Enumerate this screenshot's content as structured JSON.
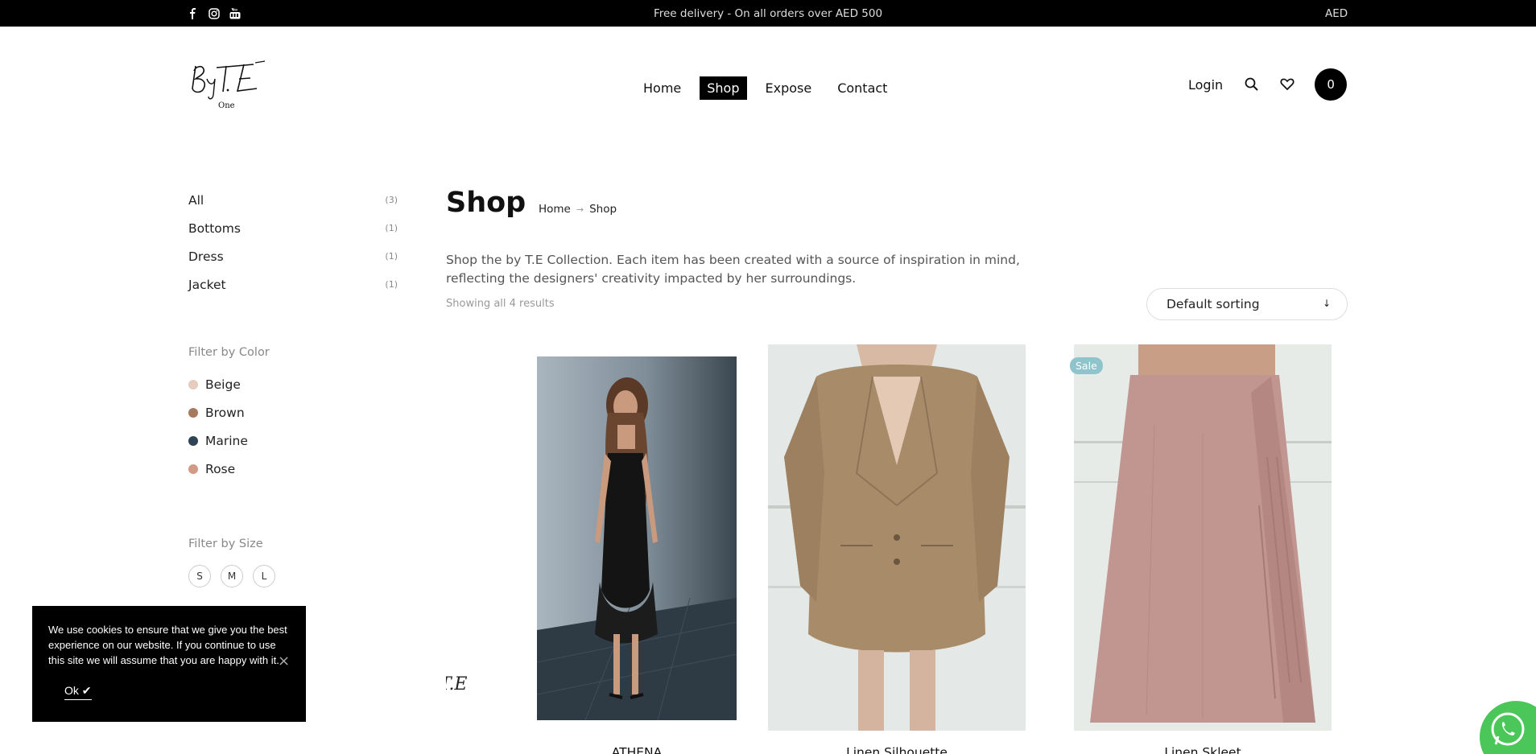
{
  "topbar": {
    "promo": "Free delivery - On all orders over AED 500",
    "currency": "AED",
    "social_icons": [
      "facebook-icon",
      "instagram-icon",
      "youtube-icon"
    ]
  },
  "header": {
    "logo_text": "ByT.E",
    "logo_sub": "One",
    "nav": [
      {
        "label": "Home",
        "active": false
      },
      {
        "label": "Shop",
        "active": true
      },
      {
        "label": "Expose",
        "active": false
      },
      {
        "label": "Contact",
        "active": false
      }
    ],
    "login": "Login",
    "cart_count": "0"
  },
  "sidebar": {
    "categories": [
      {
        "label": "All",
        "count": "(3)"
      },
      {
        "label": "Bottoms",
        "count": "(1)"
      },
      {
        "label": "Dress",
        "count": "(1)"
      },
      {
        "label": "Jacket",
        "count": "(1)"
      }
    ],
    "color_title": "Filter by Color",
    "colors": [
      {
        "label": "Beige",
        "hex": "#e6cbbf"
      },
      {
        "label": "Brown",
        "hex": "#a57a5e"
      },
      {
        "label": "Marine",
        "hex": "#2f4356"
      },
      {
        "label": "Rose",
        "hex": "#d49a88"
      }
    ],
    "size_title": "Filter by Size",
    "sizes": [
      "S",
      "M",
      "L"
    ]
  },
  "main": {
    "title": "Shop",
    "breadcrumb": [
      "Home",
      "Shop"
    ],
    "breadcrumb_sep": "→",
    "description": "Shop the by T.E Collection. Each item has been created with a source of inspiration in mind, reflecting the designers' creativity impacted by her surroundings.",
    "showing": "Showing all 4 results",
    "sort": "Default sorting",
    "sort_arrow": "↓",
    "products": [
      {
        "name": "ATHENA",
        "sale": false
      },
      {
        "name": "Linen Silhouette",
        "sale": false
      },
      {
        "name": "Linen Skleet",
        "sale": true,
        "badge": "Sale"
      }
    ],
    "partial_logo": "T.E"
  },
  "cookie": {
    "text": "We use cookies to ensure that we give you the best experience on our website. If you continue to use this site we will assume that you are happy with it.",
    "ok": "Ok ✔",
    "close": "×"
  },
  "colors": {
    "black": "#000000",
    "sale_badge": "#8fc4cd",
    "whatsapp": "#4bc659"
  }
}
